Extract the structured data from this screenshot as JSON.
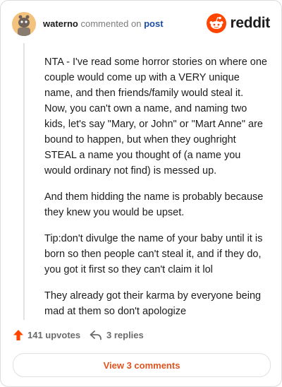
{
  "comment": {
    "username": "waterno",
    "action_text": "commented on",
    "post_link": "post",
    "paragraphs": [
      "NTA - I've read some horror stories on where one couple would come up with a VERY unique name, and then friends/family would steal it. Now, you can't own a name, and naming two kids, let's say \"Mary, or John\" or \"Mart Anne\" are bound to happen, but when they oughright STEAL a name you thought of (a name you would ordinary not find) is messed up.",
      "And them hidding the name is probably because they knew you would be upset.",
      "Tip:don't divulge the name of your baby until it is born so then people can't steal it, and if they do, you got it first so they can't claim it lol",
      "They already got their karma by everyone being mad at them so don't apologize"
    ]
  },
  "brand": {
    "name": "reddit",
    "color": "#ff4500",
    "icon": "reddit-snoo-icon"
  },
  "actions": {
    "upvotes": "141 upvotes",
    "replies": "3 replies",
    "upvote_icon": "upvote-arrow-icon",
    "reply_icon": "reply-arrow-icon"
  },
  "footer": {
    "view_comments": "View 3 comments"
  }
}
